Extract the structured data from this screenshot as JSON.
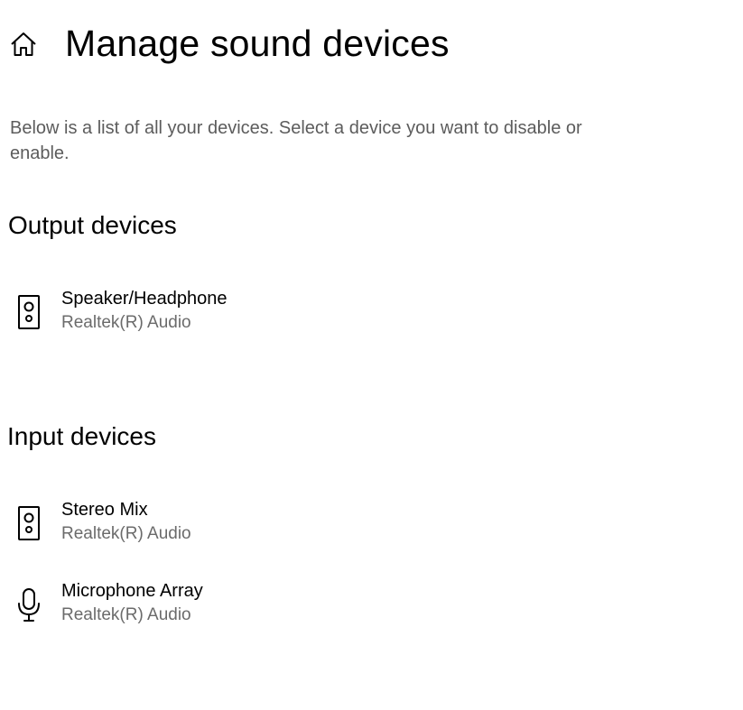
{
  "header": {
    "home_icon": "home-icon",
    "title": "Manage sound devices"
  },
  "description": "Below is a list of all your devices. Select a device you want to disable or enable.",
  "output_section": {
    "heading": "Output devices",
    "devices": [
      {
        "name": "Speaker/Headphone",
        "subtitle": "Realtek(R) Audio",
        "icon": "speaker-icon"
      }
    ]
  },
  "input_section": {
    "heading": "Input devices",
    "devices": [
      {
        "name": "Stereo Mix",
        "subtitle": "Realtek(R) Audio",
        "icon": "speaker-icon"
      },
      {
        "name": "Microphone Array",
        "subtitle": "Realtek(R) Audio",
        "icon": "microphone-icon"
      }
    ]
  }
}
